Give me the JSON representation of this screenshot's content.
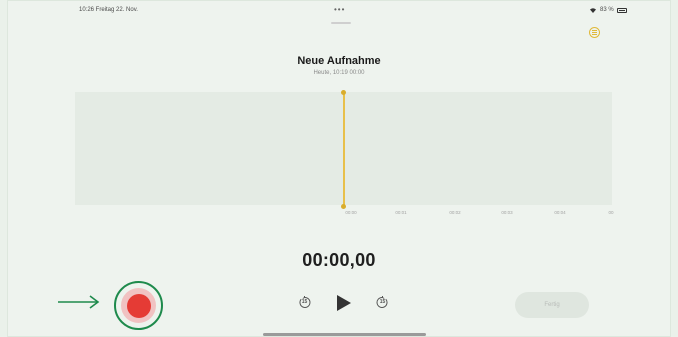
{
  "status_bar": {
    "time_date": "10:26 Freitag 22. Nov.",
    "dots": "•••",
    "wifi_battery": "83 %"
  },
  "recording": {
    "title": "Neue Aufnahme",
    "subtitle": "Heute, 10:19  00:00"
  },
  "timeline": {
    "ticks": [
      "00:00",
      "00:01",
      "00:02",
      "00:03",
      "00:04",
      "00"
    ]
  },
  "timer": "00:00,00",
  "controls": {
    "skip_back_label": "15",
    "skip_forward_label": "15",
    "done_label": "Fertig"
  },
  "colors": {
    "record": "#e53b35",
    "accent": "#e0b93a",
    "highlight": "#1e8a4c"
  },
  "icons": [
    "options-icon",
    "skip-back-15-icon",
    "play-icon",
    "skip-forward-15-icon",
    "arrow-right-icon",
    "record-icon"
  ]
}
